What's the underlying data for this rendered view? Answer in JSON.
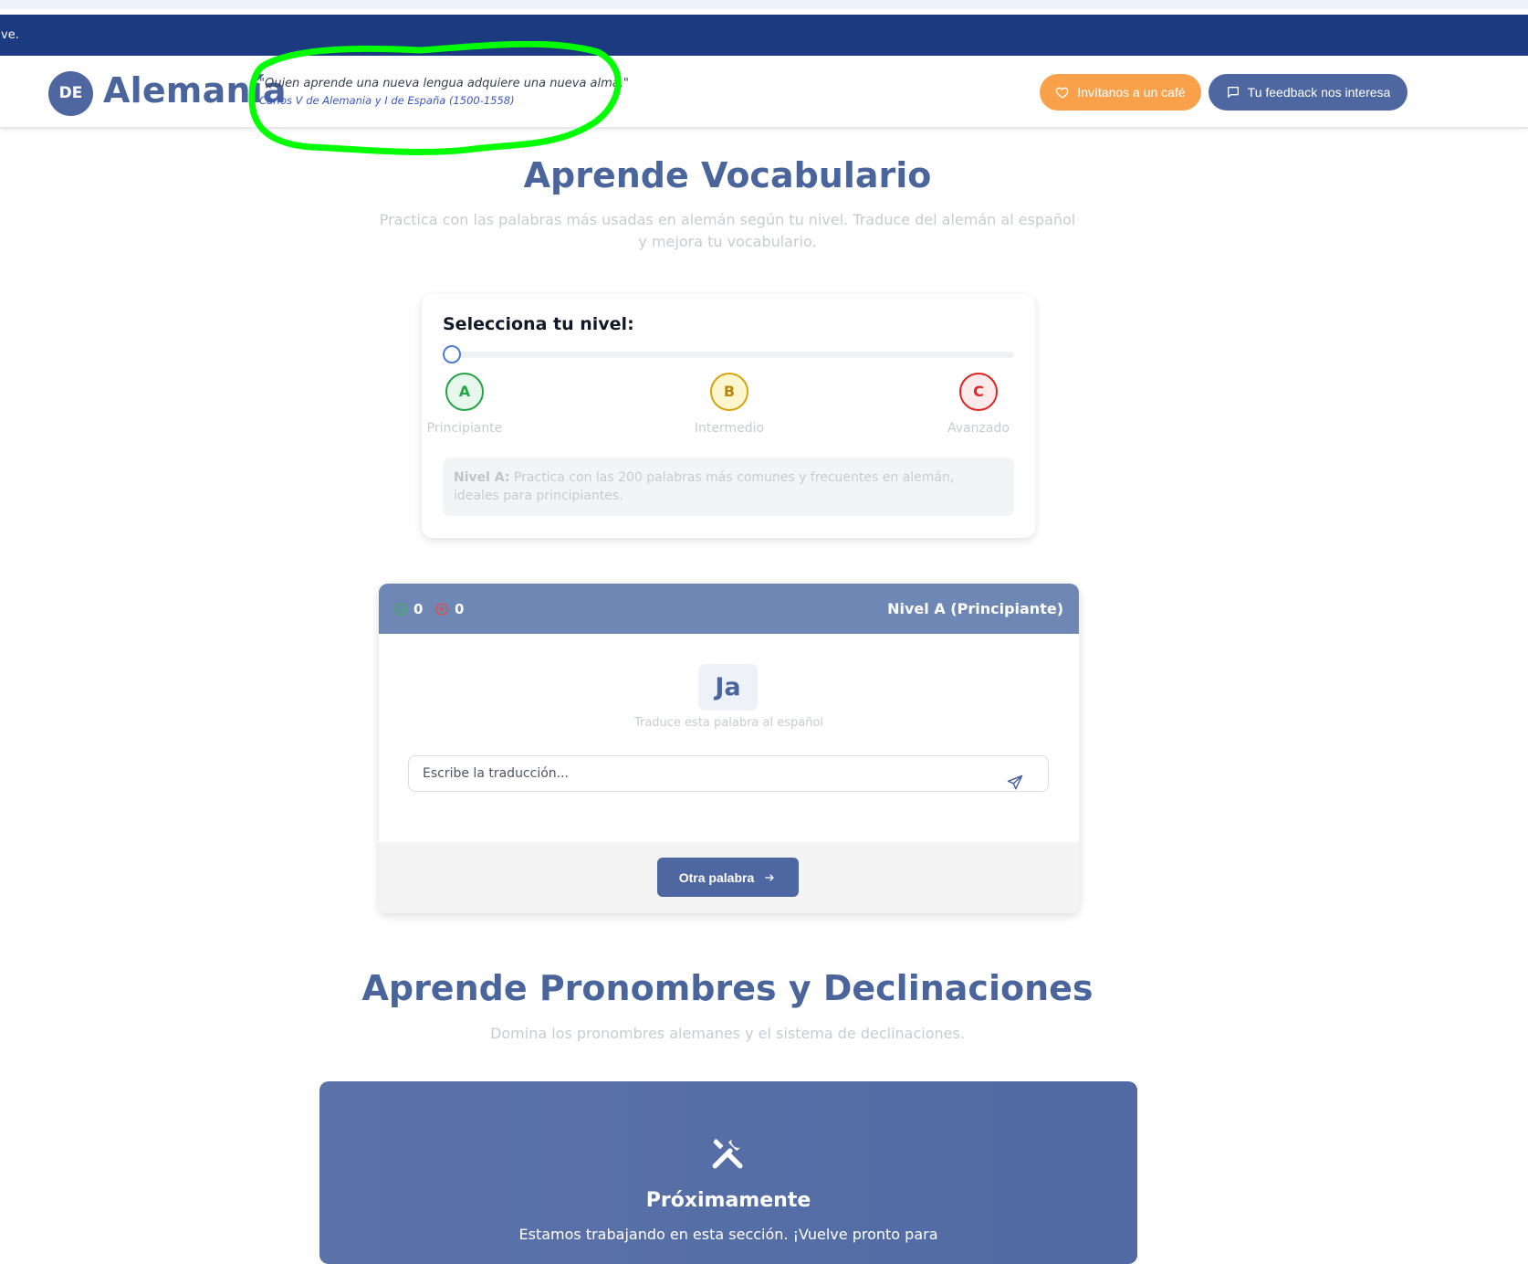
{
  "banner": {
    "text": "ve."
  },
  "header": {
    "logo_badge": "DE",
    "logo_text": "Alemanía",
    "quote": "\"Quien aprende una nueva lengua adquiere una nueva alma.\"",
    "quote_author": "Carlos V de Alemania y I de España (1500-1558)",
    "coffee_button": "Invítanos a un café",
    "feedback_button": "Tu feedback nos interesa",
    "annotation_color": "#00ff00"
  },
  "vocab": {
    "title": "Aprende Vocabulario",
    "subtitle_line1": "Practica con las palabras más usadas en alemán según tu nivel. Traduce del alemán al español",
    "subtitle_line2": "y mejora tu vocabulario."
  },
  "level_selector": {
    "title": "Selecciona tu nivel:",
    "slider_value": 0,
    "levels": [
      {
        "letter": "A",
        "label": "Principiante",
        "color": "#22a447"
      },
      {
        "letter": "B",
        "label": "Intermedio",
        "color": "#d4a50a"
      },
      {
        "letter": "C",
        "label": "Avanzado",
        "color": "#e02424"
      }
    ],
    "description_prefix": "Nivel A:",
    "description_text": " Practica con las 200 palabras más comunes y frecuentes en alemán, ideales para principiantes."
  },
  "quiz": {
    "correct_count": "0",
    "wrong_count": "0",
    "level_label": "Nivel A (Principiante)",
    "word": "Ja",
    "hint": "Traduce esta palabra al español",
    "input_placeholder": "Escribe la traducción...",
    "next_button": "Otra palabra"
  },
  "pronouns": {
    "title": "Aprende Pronombres y Declinaciones",
    "subtitle": "Domina los pronombres alemanes y el sistema de declinaciones.",
    "soon_title": "Próximamente",
    "soon_text": "Estamos trabajando en esta sección. ¡Vuelve pronto para"
  }
}
